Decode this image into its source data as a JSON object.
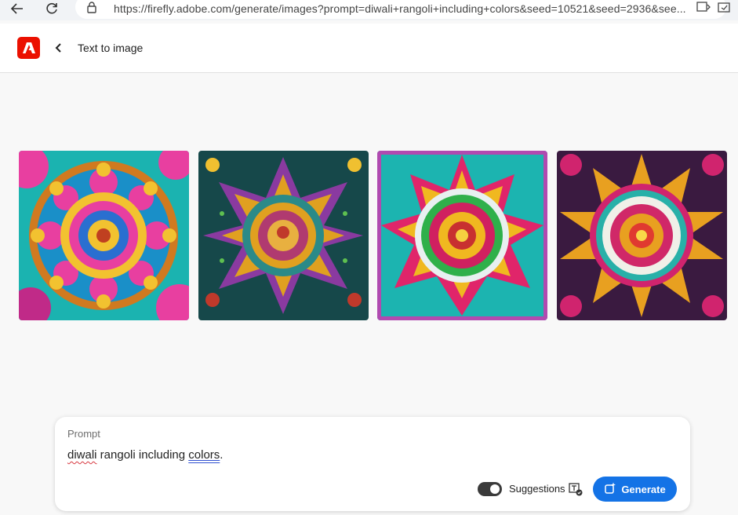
{
  "browser": {
    "url": "https://firefly.adobe.com/generate/images?prompt=diwali+rangoli+including+colors&seed=10521&seed=2936&see..."
  },
  "header": {
    "title": "Text to image",
    "logo_color": "#eb1000"
  },
  "images": [
    {
      "name": "diwali rangoli 1",
      "palette": [
        "#1bb3b0",
        "#e83fa0",
        "#f2c230",
        "#2a6fd0"
      ]
    },
    {
      "name": "diwali rangoli 2",
      "palette": [
        "#16484a",
        "#8a3aa0",
        "#e0a020",
        "#c0392b"
      ]
    },
    {
      "name": "diwali rangoli 3",
      "palette": [
        "#1cb4b0",
        "#e0256a",
        "#f0b820",
        "#2fb04a"
      ]
    },
    {
      "name": "diwali rangoli 4",
      "palette": [
        "#3a1a40",
        "#e8a020",
        "#d0246e",
        "#28b0a8"
      ]
    }
  ],
  "prompt": {
    "label": "Prompt",
    "text_part1": "diwali",
    "text_part2": " rangoli including ",
    "text_part3": "colors",
    "text_part4": ".",
    "suggestions_label": "Suggestions",
    "suggestions_on": true,
    "generate_label": "Generate",
    "accent": "#1473e6"
  }
}
